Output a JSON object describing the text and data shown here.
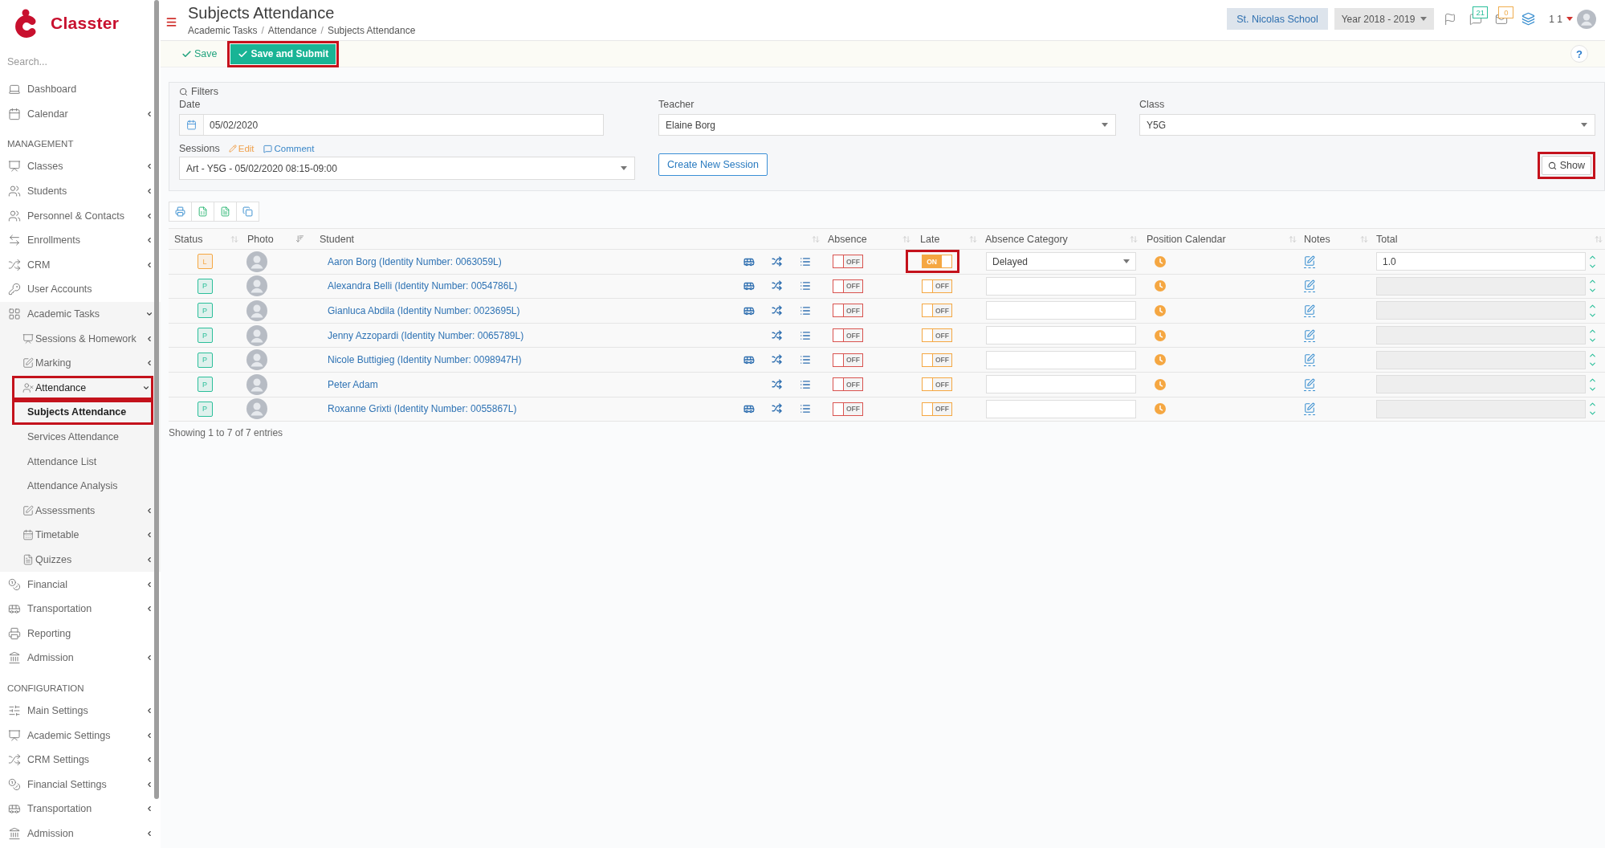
{
  "sidebar": {
    "brand": "Classter",
    "search": {
      "placeholder": "Search..."
    },
    "sections": [
      {
        "items": [
          {
            "label": "Dashboard",
            "selected": false,
            "highlighted": false
          },
          {
            "label": "Calendar",
            "expanded": false,
            "selected": false,
            "highlighted": false
          }
        ]
      },
      {
        "heading": "MANAGEMENT",
        "items": [
          {
            "label": "Classes",
            "expanded": false,
            "selected": false,
            "highlighted": false
          },
          {
            "label": "Students",
            "expanded": false,
            "selected": false,
            "highlighted": false
          },
          {
            "label": "Personnel & Contacts",
            "expanded": false,
            "selected": false,
            "highlighted": false
          },
          {
            "label": "Enrollments",
            "expanded": false,
            "selected": false,
            "highlighted": false
          },
          {
            "label": "CRM",
            "expanded": false,
            "selected": false,
            "highlighted": false
          },
          {
            "label": "User Accounts",
            "selected": false,
            "highlighted": false
          },
          {
            "label": "Academic Tasks",
            "expanded": true,
            "selected": false,
            "highlighted": false,
            "children": [
              {
                "label": "Sessions & Homework",
                "expanded": false,
                "selected": false,
                "highlighted": false
              },
              {
                "label": "Marking",
                "expanded": false,
                "selected": false,
                "highlighted": false
              },
              {
                "label": "Attendance",
                "expanded": true,
                "selected": true,
                "highlighted": true,
                "children": [
                  {
                    "label": "Subjects Attendance",
                    "selected": true,
                    "highlighted": true
                  },
                  {
                    "label": "Services Attendance",
                    "selected": false,
                    "highlighted": false
                  },
                  {
                    "label": "Attendance List",
                    "selected": false,
                    "highlighted": false
                  },
                  {
                    "label": "Attendance Analysis",
                    "selected": false,
                    "highlighted": false
                  }
                ]
              },
              {
                "label": "Assessments",
                "expanded": false,
                "selected": false,
                "highlighted": false
              },
              {
                "label": "Timetable",
                "expanded": false,
                "selected": false,
                "highlighted": false
              },
              {
                "label": "Quizzes",
                "expanded": false,
                "selected": false,
                "highlighted": false
              }
            ]
          },
          {
            "label": "Financial",
            "expanded": false,
            "selected": false,
            "highlighted": false
          },
          {
            "label": "Transportation",
            "expanded": false,
            "selected": false,
            "highlighted": false
          },
          {
            "label": "Reporting",
            "selected": false,
            "highlighted": false
          },
          {
            "label": "Admission",
            "expanded": false,
            "selected": false,
            "highlighted": false
          }
        ]
      },
      {
        "heading": "CONFIGURATION",
        "items": [
          {
            "label": "Main Settings",
            "expanded": false,
            "selected": false,
            "highlighted": false
          },
          {
            "label": "Academic Settings",
            "expanded": false,
            "selected": false,
            "highlighted": false
          },
          {
            "label": "CRM Settings",
            "expanded": false,
            "selected": false,
            "highlighted": false
          },
          {
            "label": "Financial Settings",
            "expanded": false,
            "selected": false,
            "highlighted": false
          },
          {
            "label": "Transportation",
            "expanded": false,
            "selected": false,
            "highlighted": false
          },
          {
            "label": "Admission",
            "expanded": false,
            "selected": false,
            "highlighted": false
          }
        ]
      }
    ]
  },
  "header": {
    "title": "Subjects Attendance",
    "breadcrumb": [
      "Academic Tasks",
      "Attendance",
      "Subjects Attendance"
    ],
    "breadcrumb_separator": "/",
    "school": "St. Nicolas School",
    "year": "Year 2018 - 2019",
    "notifications": [
      {
        "count": "21",
        "color": "#2bbf9a"
      },
      {
        "count": "0",
        "color": "#f0ad4e"
      }
    ],
    "user": "1 1"
  },
  "toolbar": {
    "actions": [
      {
        "label": "Save",
        "kind": "link",
        "highlighted": false
      },
      {
        "label": "Save and Submit",
        "kind": "primary",
        "highlighted": true
      }
    ],
    "help": "?"
  },
  "filters": {
    "title": "Filters",
    "date": {
      "label": "Date",
      "value": "05/02/2020"
    },
    "teacher": {
      "label": "Teacher",
      "value": "Elaine Borg"
    },
    "class": {
      "label": "Class",
      "value": "Y5G"
    },
    "sessions": {
      "label": "Sessions",
      "edit": "Edit",
      "comment": "Comment",
      "value": "Art - Y5G - 05/02/2020 08:15-09:00"
    },
    "create_button": "Create New Session",
    "show_button": {
      "label": "Show",
      "highlighted": true
    }
  },
  "table": {
    "columns": [
      {
        "label": "Status",
        "sorted": false
      },
      {
        "label": "Photo",
        "sorted": true
      },
      {
        "label": "Student",
        "sorted": false
      },
      {
        "label": "Absence",
        "sorted": false
      },
      {
        "label": "Late",
        "sorted": false
      },
      {
        "label": "Absence Category",
        "sorted": false
      },
      {
        "label": "Position Calendar",
        "sorted": false
      },
      {
        "label": "Notes",
        "sorted": false
      },
      {
        "label": "Total",
        "sorted": false
      }
    ],
    "rows": [
      {
        "status": {
          "label": "L",
          "color": "#f5a742"
        },
        "student": "Aaron Borg (Identity Number: 0063059L)",
        "transport": true,
        "absence": {
          "on": false,
          "text": "OFF"
        },
        "late": {
          "on": true,
          "text": "ON",
          "highlighted": true
        },
        "absence_category": "Delayed",
        "total": {
          "value": "1.0",
          "disabled": false
        }
      },
      {
        "status": {
          "label": "P",
          "color": "#2bbf9a"
        },
        "student": "Alexandra Belli (Identity Number: 0054786L)",
        "transport": true,
        "absence": {
          "on": false,
          "text": "OFF"
        },
        "late": {
          "on": false,
          "text": "OFF",
          "highlighted": false
        },
        "total": {
          "disabled": true
        }
      },
      {
        "status": {
          "label": "P",
          "color": "#2bbf9a"
        },
        "student": "Gianluca Abdila (Identity Number: 0023695L)",
        "transport": true,
        "absence": {
          "on": false,
          "text": "OFF"
        },
        "late": {
          "on": false,
          "text": "OFF",
          "highlighted": false
        },
        "total": {
          "disabled": true
        }
      },
      {
        "status": {
          "label": "P",
          "color": "#2bbf9a"
        },
        "student": "Jenny Azzopardi (Identity Number: 0065789L)",
        "transport": false,
        "absence": {
          "on": false,
          "text": "OFF"
        },
        "late": {
          "on": false,
          "text": "OFF",
          "highlighted": false
        },
        "total": {
          "disabled": true
        }
      },
      {
        "status": {
          "label": "P",
          "color": "#2bbf9a"
        },
        "student": "Nicole Buttigieg (Identity Number: 0098947H)",
        "transport": true,
        "absence": {
          "on": false,
          "text": "OFF"
        },
        "late": {
          "on": false,
          "text": "OFF",
          "highlighted": false
        },
        "total": {
          "disabled": true
        }
      },
      {
        "status": {
          "label": "P",
          "color": "#2bbf9a"
        },
        "student": "Peter Adam",
        "transport": false,
        "absence": {
          "on": false,
          "text": "OFF"
        },
        "late": {
          "on": false,
          "text": "OFF",
          "highlighted": false
        },
        "total": {
          "disabled": true
        }
      },
      {
        "status": {
          "label": "P",
          "color": "#2bbf9a"
        },
        "student": "Roxanne Grixti (Identity Number: 0055867L)",
        "transport": true,
        "absence": {
          "on": false,
          "text": "OFF"
        },
        "late": {
          "on": false,
          "text": "OFF",
          "highlighted": false
        },
        "total": {
          "disabled": true
        }
      }
    ],
    "info": "Showing 1 to 7 of 7 entries"
  }
}
